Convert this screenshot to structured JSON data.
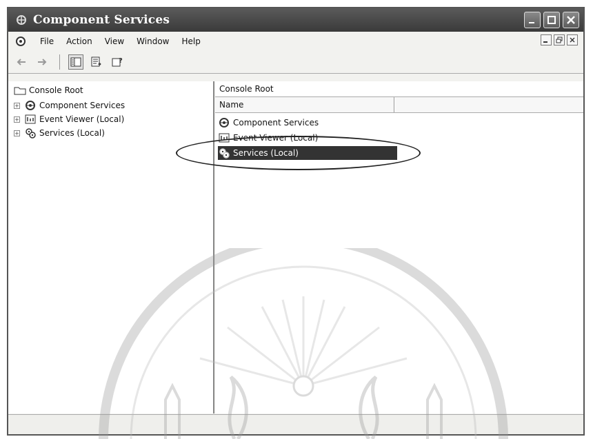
{
  "window": {
    "title": "Component Services",
    "title_icon": "component-services-icon"
  },
  "title_buttons": [
    {
      "name": "minimize",
      "icon": "minimize-icon"
    },
    {
      "name": "maximize",
      "icon": "maximize-icon"
    },
    {
      "name": "close",
      "icon": "close-icon"
    }
  ],
  "menu": {
    "icon": "app-menu-icon",
    "items": [
      "File",
      "Action",
      "View",
      "Window",
      "Help"
    ]
  },
  "toolbar": {
    "buttons": [
      "back-arrow-icon",
      "forward-arrow-icon",
      "show-hide-tree-icon",
      "export-list-icon",
      "help-icon"
    ]
  },
  "tree": {
    "root_label": "Console Root",
    "items": [
      {
        "label": "Component Services",
        "icon": "component-services-icon"
      },
      {
        "label": "Event Viewer (Local)",
        "icon": "event-viewer-icon"
      },
      {
        "label": "Services (Local)",
        "icon": "services-icon"
      }
    ]
  },
  "right_pane": {
    "title": "Console Root",
    "columns": [
      "Name",
      ""
    ],
    "items": [
      {
        "label": "Component Services",
        "icon": "component-services-icon",
        "selected": false
      },
      {
        "label": "Event Viewer (Local)",
        "icon": "event-viewer-icon",
        "selected": false
      },
      {
        "label": "Services (Local)",
        "icon": "services-icon",
        "selected": true
      }
    ]
  },
  "colors": {
    "selection": "#333333",
    "titlebar": "#4a4a4a"
  }
}
